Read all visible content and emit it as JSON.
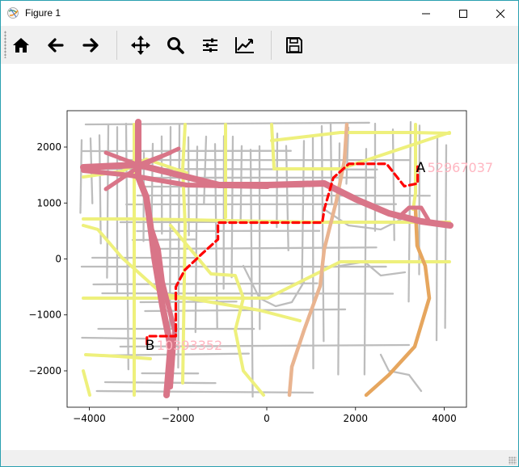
{
  "window": {
    "title": "Figure 1"
  },
  "toolbar": {
    "items": [
      {
        "name": "home-icon"
      },
      {
        "name": "back-arrow-icon"
      },
      {
        "name": "forward-arrow-icon"
      },
      {
        "name": "pan-icon"
      },
      {
        "name": "zoom-icon"
      },
      {
        "name": "configure-subplots-icon"
      },
      {
        "name": "edit-axis-icon"
      },
      {
        "name": "save-icon"
      }
    ]
  },
  "chart_data": {
    "type": "map-plot",
    "title": "",
    "xlabel": "",
    "ylabel": "",
    "xlim": [
      -4500,
      4500
    ],
    "ylim": [
      -2650,
      2650
    ],
    "xticks": [
      -4000,
      -2000,
      0,
      2000,
      4000
    ],
    "yticks": [
      2000,
      1000,
      0,
      -1000,
      -2000
    ],
    "xtick_labels": [
      "−4000",
      "−2000",
      "0",
      "2000",
      "4000"
    ],
    "ytick_labels": [
      "2000",
      "1000",
      "0",
      "−1000",
      "−2000"
    ],
    "route": {
      "color": "#ff0000",
      "style": "dashed",
      "points": [
        [
          -2700,
          -1520
        ],
        [
          -2700,
          -1380
        ],
        [
          -2050,
          -1380
        ],
        [
          -2050,
          -500
        ],
        [
          -1850,
          -200
        ],
        [
          -1450,
          100
        ],
        [
          -1100,
          350
        ],
        [
          -1100,
          650
        ],
        [
          0,
          650
        ],
        [
          1250,
          650
        ],
        [
          1300,
          900
        ],
        [
          1500,
          1450
        ],
        [
          1850,
          1700
        ],
        [
          2700,
          1700
        ],
        [
          3100,
          1300
        ],
        [
          3400,
          1350
        ],
        [
          3400,
          1650
        ]
      ]
    },
    "markers": [
      {
        "label": "A",
        "x": 3400,
        "y": 1650,
        "id_label": "52967037"
      },
      {
        "label": "B",
        "x": -2700,
        "y": -1520,
        "id_label": "10393352"
      }
    ],
    "colors": {
      "minor_roads": "#bdbdbd",
      "secondary_roads": "#eef07c",
      "highway": "#d97588",
      "arterial": "#e9b490",
      "route": "#ff0000",
      "id_label": "#ffb6c1"
    }
  }
}
